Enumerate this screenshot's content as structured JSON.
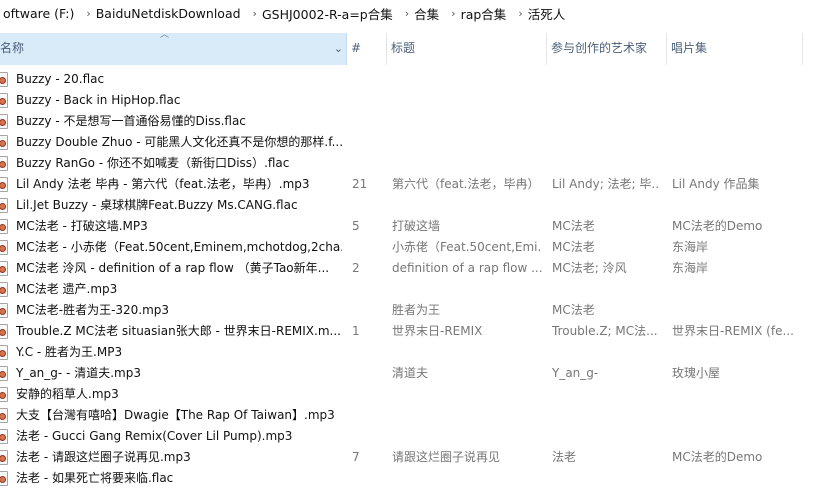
{
  "breadcrumb": [
    "oftware (F:)",
    "BaiduNetdiskDownload",
    "GSHJ0002-R-a=p合集",
    "合集",
    "rap合集",
    "活死人"
  ],
  "columns": {
    "name": "名称",
    "number": "#",
    "title": "标题",
    "artists": "参与创作的艺术家",
    "album": "唱片集"
  },
  "files": [
    {
      "name": "Buzzy - 20.flac",
      "number": "",
      "title": "",
      "artists": "",
      "album": ""
    },
    {
      "name": "Buzzy - Back in HipHop.flac",
      "number": "",
      "title": "",
      "artists": "",
      "album": ""
    },
    {
      "name": "Buzzy - 不是想写一首通俗易懂的Diss.flac",
      "number": "",
      "title": "",
      "artists": "",
      "album": ""
    },
    {
      "name": "Buzzy Double Zhuo - 可能黑人文化还真不是你想的那样.f...",
      "number": "",
      "title": "",
      "artists": "",
      "album": ""
    },
    {
      "name": "Buzzy RanGo - 你还不如喊麦（新街口Diss）.flac",
      "number": "",
      "title": "",
      "artists": "",
      "album": ""
    },
    {
      "name": "Lil Andy 法老 毕冉 - 第六代（feat.法老，毕冉）.mp3",
      "number": "21",
      "title": "第六代（feat.法老，毕冉）",
      "artists": "Lil Andy; 法老; 毕...",
      "album": "Lil Andy 作品集"
    },
    {
      "name": "Lil.Jet Buzzy - 桌球棋牌Feat.Buzzy Ms.CANG.flac",
      "number": "",
      "title": "",
      "artists": "",
      "album": ""
    },
    {
      "name": "MC法老 - 打破这墙.MP3",
      "number": "5",
      "title": "打破这墙",
      "artists": "MC法老",
      "album": "MC法老的Demo"
    },
    {
      "name": "MC法老 - 小赤佬（Feat.50cent,Eminem,mchotdog,2cha...",
      "number": "",
      "title": "小赤佬（Feat.50cent,Emi...",
      "artists": "MC法老",
      "album": "东海岸"
    },
    {
      "name": "MC法老 泠风 - definition of a rap flow （黄子Tao新年...",
      "number": "2",
      "title": "definition of a rap flow ...",
      "artists": "MC法老; 泠风",
      "album": "东海岸"
    },
    {
      "name": "MC法老 遗产.mp3",
      "number": "",
      "title": "",
      "artists": "",
      "album": ""
    },
    {
      "name": "MC法老-胜者为王-320.mp3",
      "number": "",
      "title": "胜者为王",
      "artists": "MC法老",
      "album": ""
    },
    {
      "name": "Trouble.Z MC法老 situasian张大郎 - 世界末日-REMIX.m...",
      "number": "1",
      "title": "世界末日-REMIX",
      "artists": "Trouble.Z; MC法...",
      "album": "世界末日-REMIX (fe..."
    },
    {
      "name": "Y.C - 胜者为王.MP3",
      "number": "",
      "title": "",
      "artists": "",
      "album": ""
    },
    {
      "name": "Y_an_g- - 清道夫.mp3",
      "number": "",
      "title": "清道夫",
      "artists": "Y_an_g-",
      "album": "玫瑰小屋"
    },
    {
      "name": "安静的稻草人.mp3",
      "number": "",
      "title": "",
      "artists": "",
      "album": ""
    },
    {
      "name": "大支【台灣有嘻哈】Dwagie【The Rap Of Taiwan】.mp3",
      "number": "",
      "title": "",
      "artists": "",
      "album": ""
    },
    {
      "name": "法老 - Gucci Gang Remix(Cover Lil Pump).mp3",
      "number": "",
      "title": "",
      "artists": "",
      "album": ""
    },
    {
      "name": "法老 - 请跟这烂圈子说再见.mp3",
      "number": "7",
      "title": "请跟这烂圈子说再见",
      "artists": "法老",
      "album": "MC法老的Demo"
    },
    {
      "name": "法老 - 如果死亡将要来临.flac",
      "number": "",
      "title": "",
      "artists": "",
      "album": ""
    }
  ]
}
